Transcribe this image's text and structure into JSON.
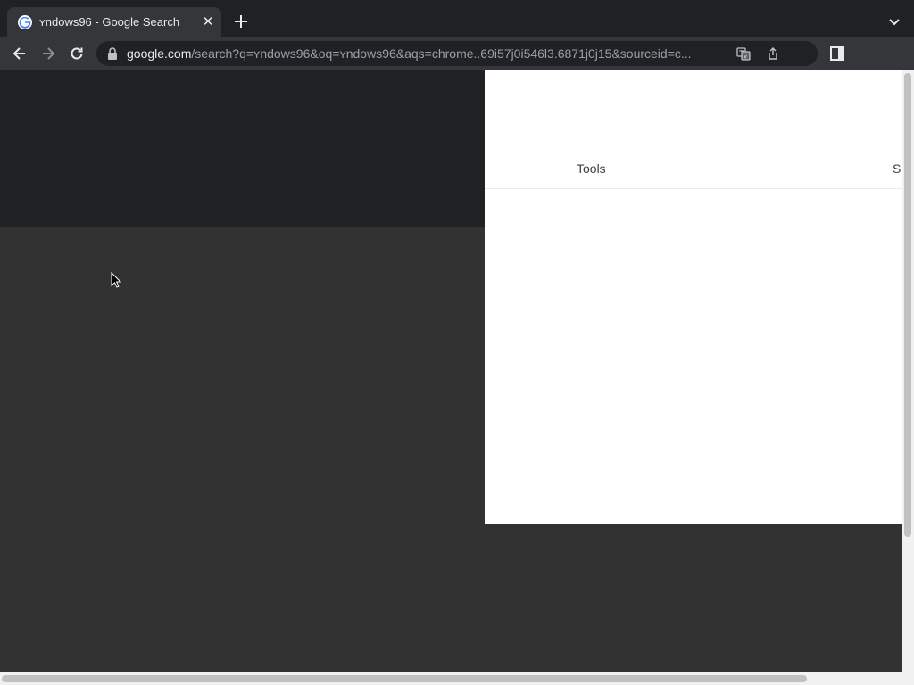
{
  "tab": {
    "title": "ʏndows96 - Google Search",
    "close_label": "✕"
  },
  "toolbar": {
    "url_host": "google.com",
    "url_path": "/search?q=ʏndows96&oq=ʏndows96&aqs=chrome..69i57j0i546l3.6871j0j15&sourceid=c..."
  },
  "page": {
    "tools_label": "Tools",
    "cut_label": "S"
  },
  "icons": {
    "favicon": "google-g-icon",
    "new_tab": "plus-icon",
    "tab_menu": "chevron-down-icon",
    "back": "arrow-left-icon",
    "forward": "arrow-right-icon",
    "reload": "reload-icon",
    "lock": "lock-icon",
    "translate": "translate-icon",
    "share": "share-icon",
    "side_panel": "side-panel-icon"
  },
  "colors": {
    "chrome_dark": "#202124",
    "toolbar": "#35363a",
    "page_dim": "#323232",
    "panel": "#ffffff"
  }
}
